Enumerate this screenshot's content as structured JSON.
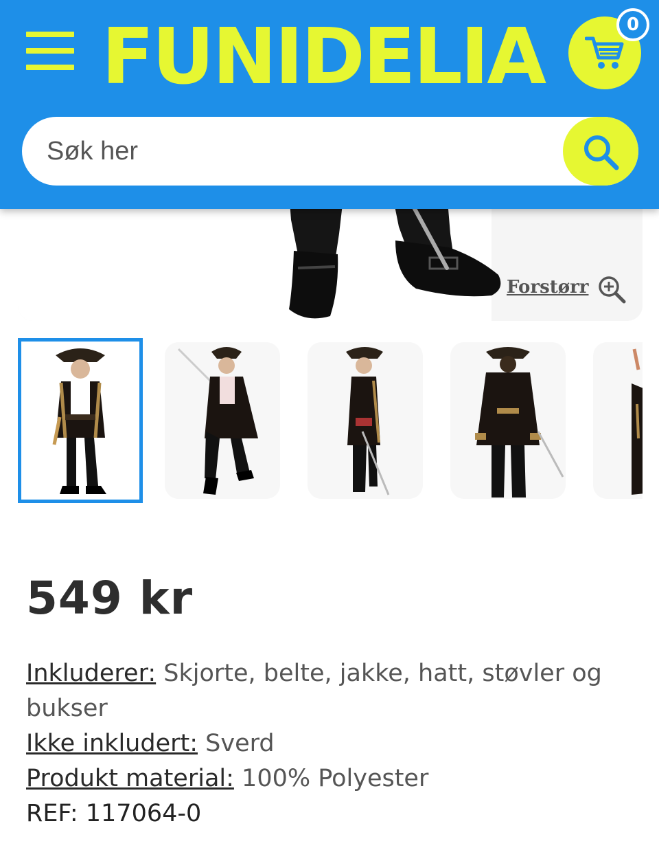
{
  "header": {
    "logo_text": "FUNIDELIA",
    "cart_count": "0",
    "brand_color": "#1e8fe8",
    "accent_color": "#e6f732",
    "menu_icon": "hamburger-menu-icon",
    "cart_icon": "shopping-cart-icon"
  },
  "search": {
    "placeholder": "Søk her",
    "icon": "search-icon"
  },
  "gallery": {
    "zoom_label": "Forstørr",
    "zoom_icon": "zoom-in-icon",
    "thumbnail_count": 5,
    "active_thumbnail": 1
  },
  "product": {
    "price": "549 kr",
    "details": [
      {
        "label": "Inkluderer:",
        "value": " Skjorte, belte, jakke, hatt, støvler og bukser"
      },
      {
        "label": "Ikke inkludert:",
        "value": " Sverd"
      },
      {
        "label": "Produkt material:",
        "value": " 100% Polyester"
      }
    ],
    "ref": "REF: 117064-0"
  }
}
